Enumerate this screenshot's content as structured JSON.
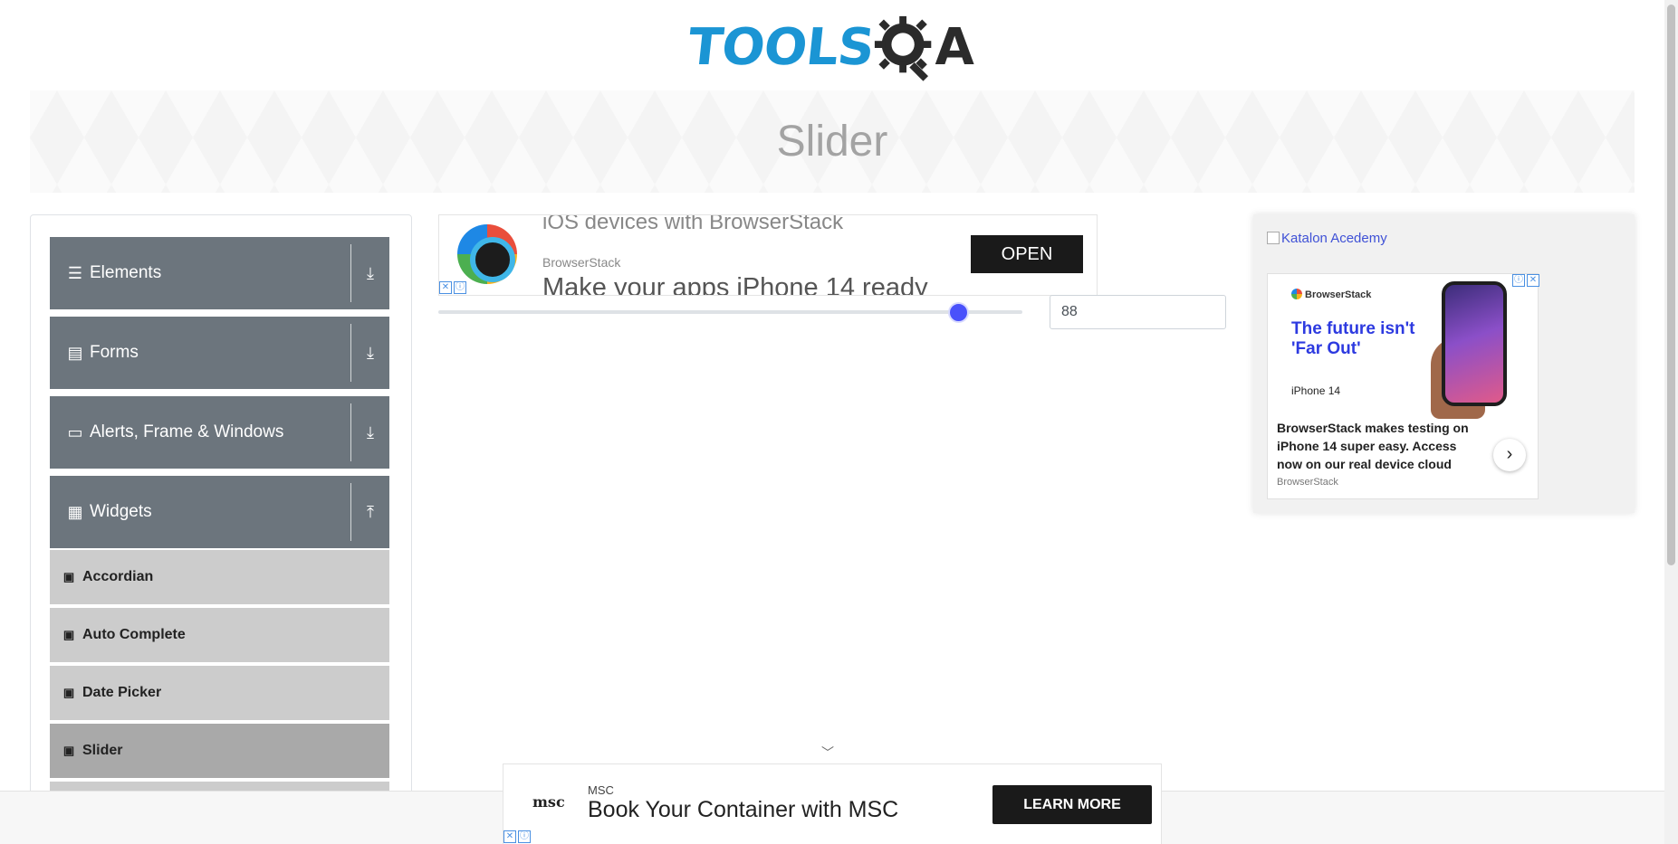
{
  "header": {
    "logo_text": "TOOLS",
    "logo_suffix": "A"
  },
  "banner": {
    "title": "Slider"
  },
  "sidebar": {
    "groups": [
      {
        "label": "Elements",
        "icon": "hamburger-icon",
        "toggle": "download-icon"
      },
      {
        "label": "Forms",
        "icon": "document-icon",
        "toggle": "download-icon"
      },
      {
        "label": "Alerts, Frame & Windows",
        "icon": "window-icon",
        "toggle": "download-icon"
      },
      {
        "label": "Widgets",
        "icon": "grid-icon",
        "toggle": "upload-icon"
      }
    ],
    "items": [
      {
        "label": "Accordian",
        "active": false
      },
      {
        "label": "Auto Complete",
        "active": false
      },
      {
        "label": "Date Picker",
        "active": false
      },
      {
        "label": "Slider",
        "active": true
      }
    ]
  },
  "ad_top": {
    "line1": "iOS devices with BrowserStack",
    "brand": "BrowserStack",
    "line2": "Make your apps iPhone 14 ready",
    "button": "OPEN"
  },
  "slider": {
    "value": "88",
    "min": 0,
    "max": 100,
    "level": 0.88,
    "accent": "#4951fb"
  },
  "right_panel": {
    "link": "Katalon Acedemy",
    "ad": {
      "brand": "BrowserStack",
      "headline": "The future isn't 'Far Out'",
      "product": "iPhone 14",
      "body": "BrowserStack makes testing on iPhone 14 super easy. Access now on our real device cloud",
      "source": "BrowserStack"
    }
  },
  "ad_bottom": {
    "logo": "msc",
    "brand": "MSC",
    "title": "Book Your Container with MSC",
    "button": "LEARN MORE"
  },
  "colors": {
    "sidebar_group": "#6c757d",
    "sidebar_item": "#cccccc",
    "sidebar_item_active": "#a9a9a9",
    "logo_blue": "#1b95d4"
  }
}
